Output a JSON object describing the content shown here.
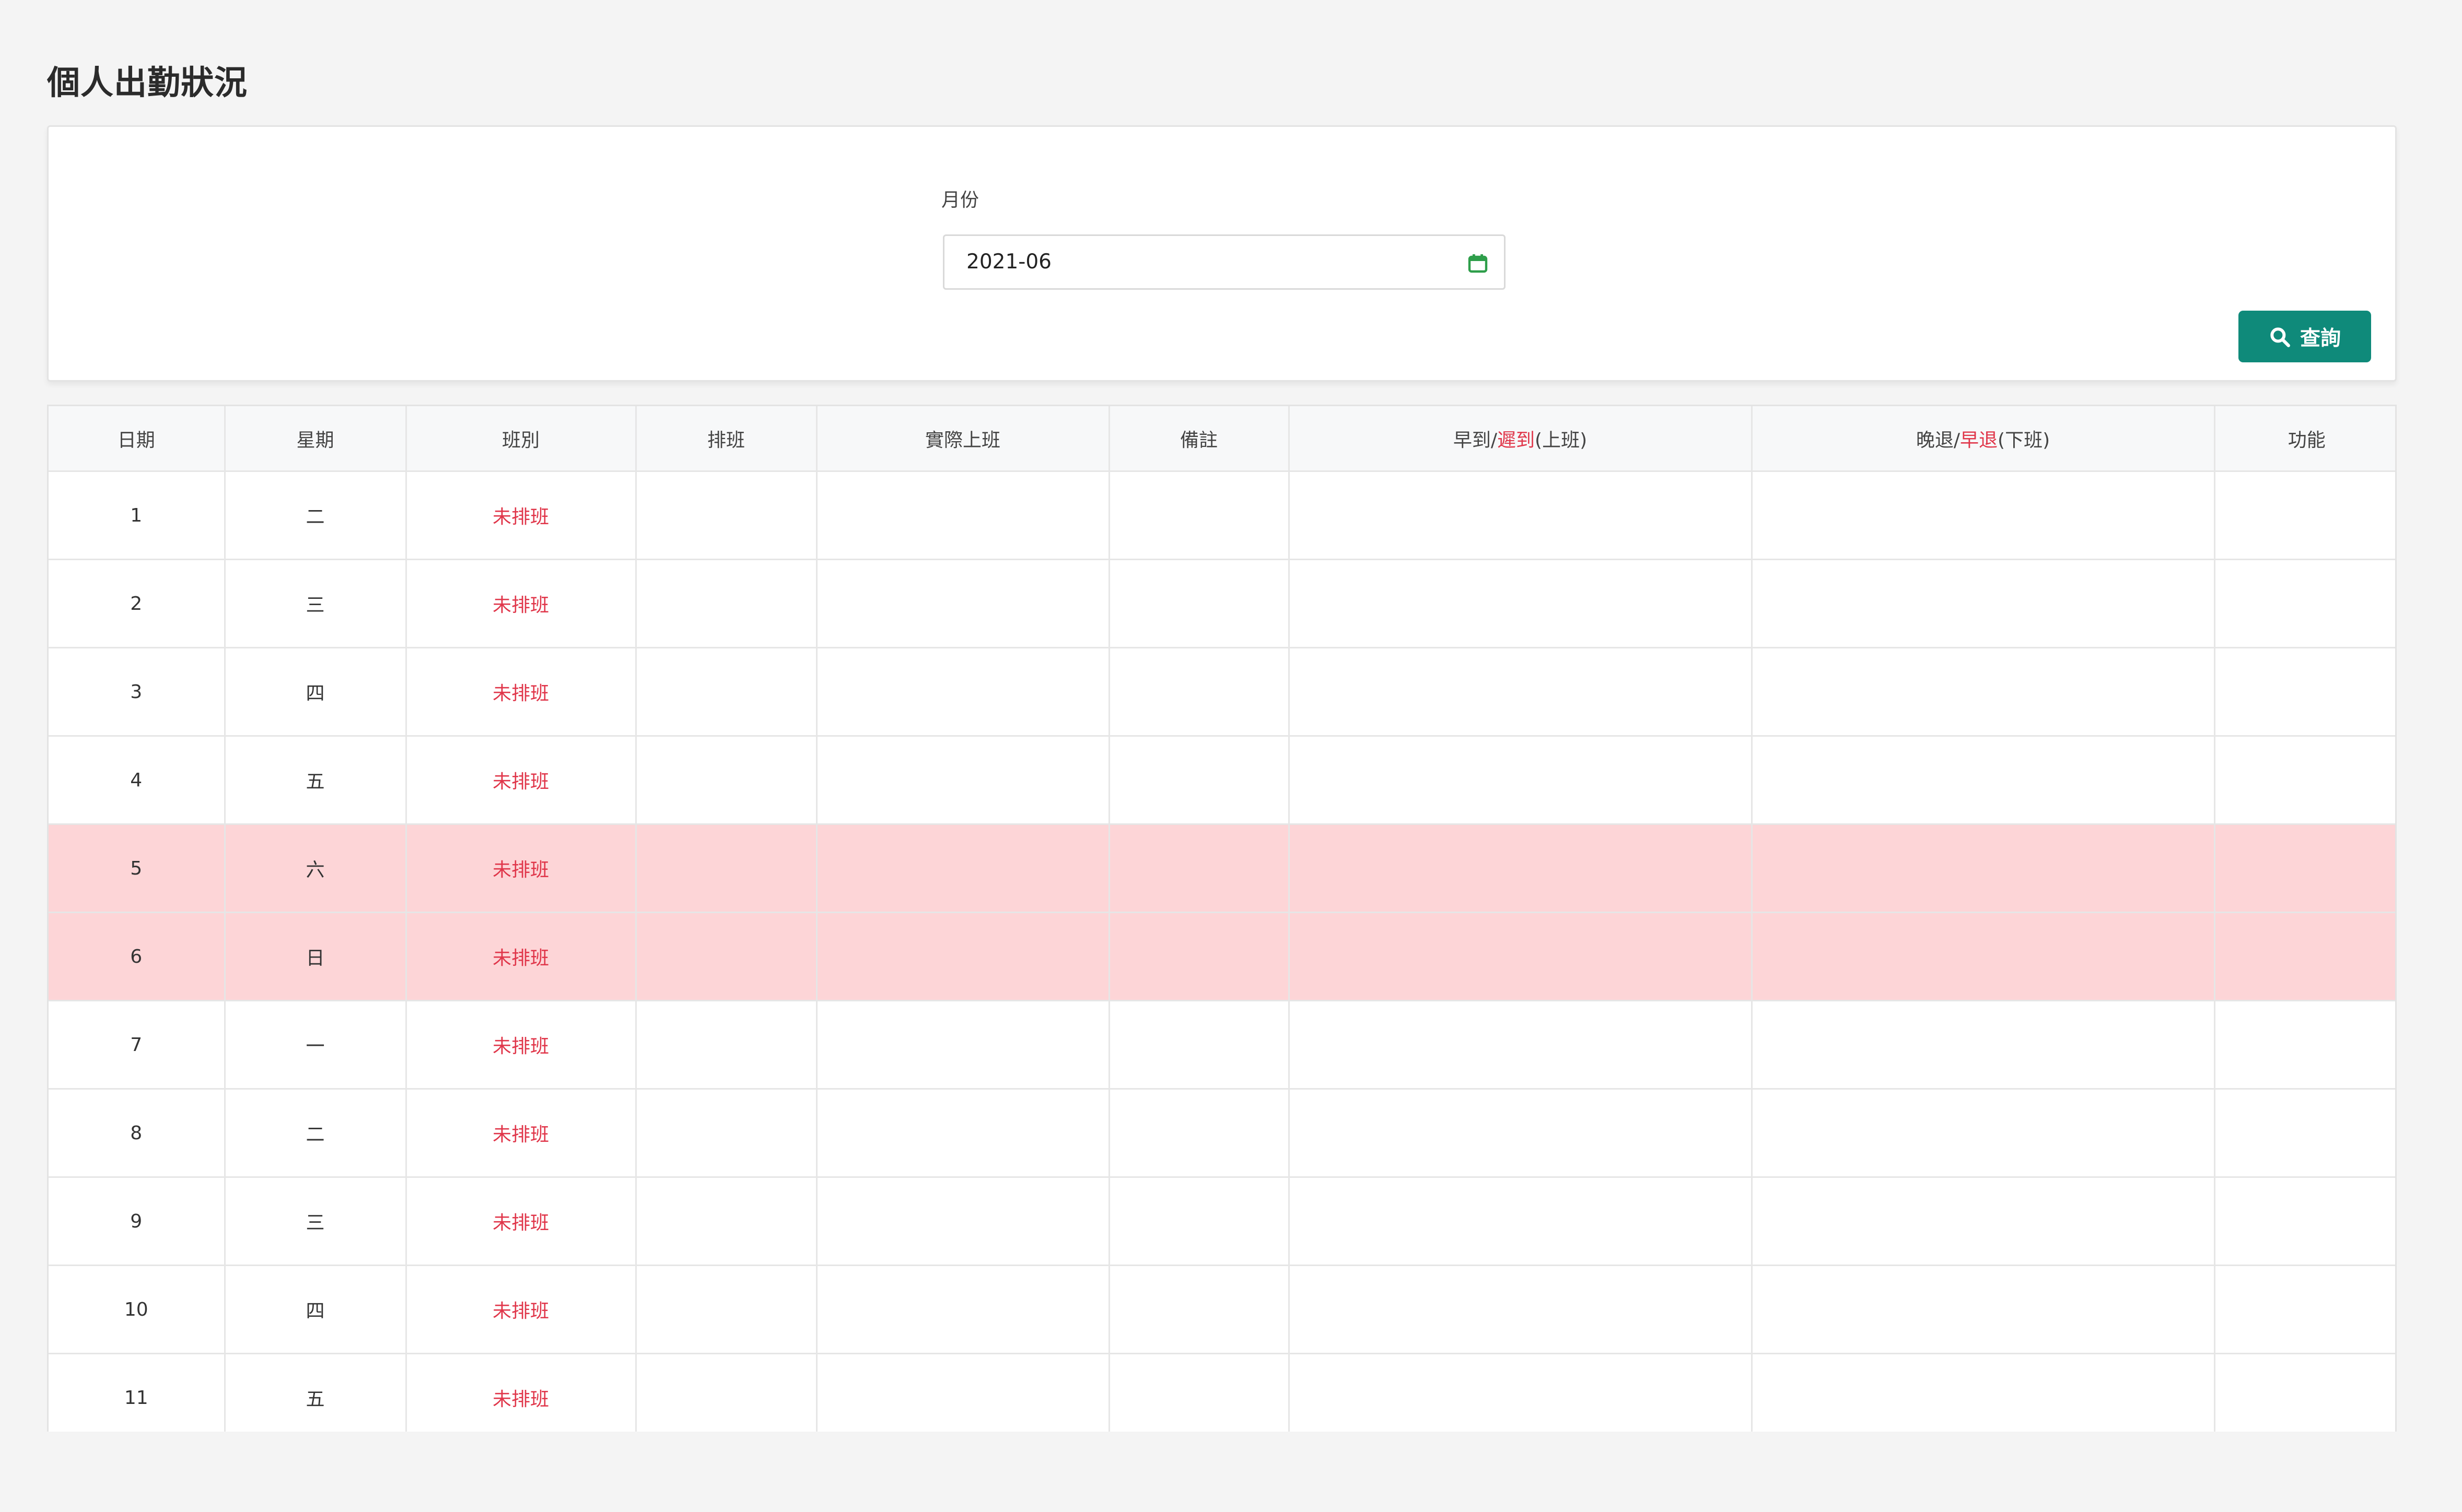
{
  "page": {
    "title": "個人出勤狀況"
  },
  "filter": {
    "month_label": "月份",
    "month_value": "2021-06",
    "search_label": "查詢"
  },
  "table": {
    "headers": {
      "date": "日期",
      "weekday": "星期",
      "shift": "班別",
      "schedule": "排班",
      "actual": "實際上班",
      "remark": "備註",
      "early_prefix": "早到/",
      "early_red": "遲到",
      "early_suffix": "(上班)",
      "late_prefix": "晚退/",
      "late_red": "早退",
      "late_suffix": "(下班)",
      "function": "功能"
    },
    "rows": [
      {
        "date": "1",
        "weekday": "二",
        "shift": "未排班",
        "weekend": false
      },
      {
        "date": "2",
        "weekday": "三",
        "shift": "未排班",
        "weekend": false
      },
      {
        "date": "3",
        "weekday": "四",
        "shift": "未排班",
        "weekend": false
      },
      {
        "date": "4",
        "weekday": "五",
        "shift": "未排班",
        "weekend": false
      },
      {
        "date": "5",
        "weekday": "六",
        "shift": "未排班",
        "weekend": true
      },
      {
        "date": "6",
        "weekday": "日",
        "shift": "未排班",
        "weekend": true
      },
      {
        "date": "7",
        "weekday": "一",
        "shift": "未排班",
        "weekend": false
      },
      {
        "date": "8",
        "weekday": "二",
        "shift": "未排班",
        "weekend": false
      },
      {
        "date": "9",
        "weekday": "三",
        "shift": "未排班",
        "weekend": false
      },
      {
        "date": "10",
        "weekday": "四",
        "shift": "未排班",
        "weekend": false
      },
      {
        "date": "11",
        "weekday": "五",
        "shift": "未排班",
        "weekend": false
      }
    ]
  },
  "colors": {
    "accent": "#0f8a7a",
    "alert": "#e0364a",
    "weekend_row": "#fdd5d7",
    "calendar_icon": "#2e9e4a"
  },
  "icons": {
    "calendar": "calendar-icon",
    "search": "search-icon"
  }
}
